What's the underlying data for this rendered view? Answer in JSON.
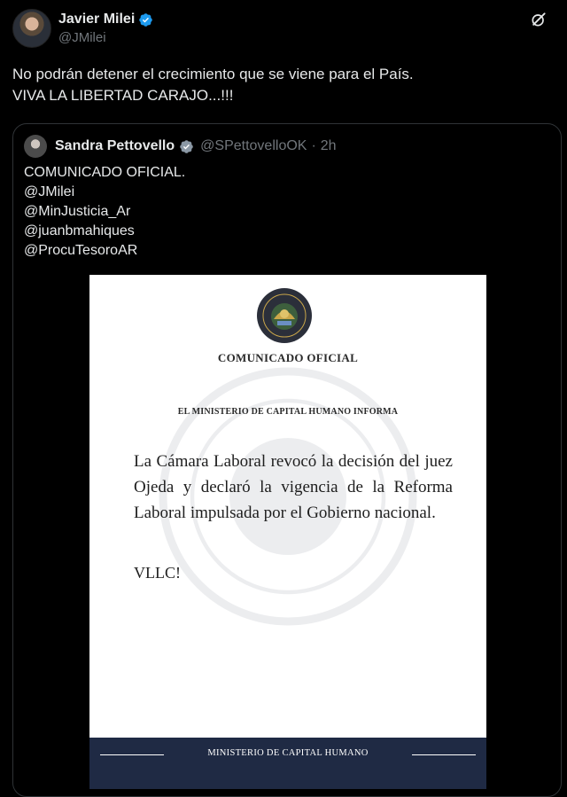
{
  "author": {
    "display_name": "Javier Milei",
    "handle": "@JMilei"
  },
  "tweet": {
    "lines": [
      "No podrán detener el crecimiento que se viene para el País.",
      "VIVA LA LIBERTAD CARAJO...!!!"
    ]
  },
  "quoted": {
    "display_name": "Sandra Pettovello",
    "handle": "@SPettovelloOK",
    "separator": "·",
    "time": "2h",
    "lines": [
      "COMUNICADO OFICIAL.",
      "@JMilei",
      "@MinJusticia_Ar",
      "@juanbmahiques",
      "@ProcuTesoroAR"
    ],
    "document": {
      "title": "COMUNICADO OFICIAL",
      "subtitle": "EL MINISTERIO DE CAPITAL HUMANO INFORMA",
      "body": "La Cámara Laboral revocó la decisión del juez Ojeda y declaró la vigencia de la Reforma Laboral impulsada por el Gobierno nacional.",
      "sign_off": "VLLC!",
      "footer": "MINISTERIO DE CAPITAL HUMANO"
    }
  },
  "colors": {
    "background": "#000000",
    "verified": "#1d9bf0",
    "secondary_text": "#71767b",
    "doc_footer": "#1f2a44"
  },
  "icons": {
    "verified": "verified-badge-icon",
    "grok": "grok-icon"
  }
}
